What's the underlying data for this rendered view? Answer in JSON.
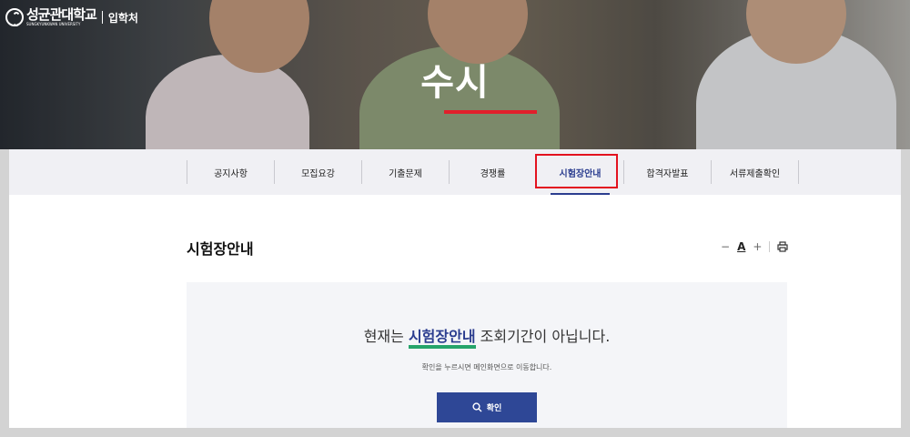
{
  "logo": {
    "name": "성균관대학교",
    "eng": "SUNGKYUNKWAN UNIVERSITY",
    "sub": "입학처"
  },
  "hero": {
    "title": "수시"
  },
  "tabs": [
    {
      "label": "공지사항"
    },
    {
      "label": "모집요강"
    },
    {
      "label": "기출문제"
    },
    {
      "label": "경쟁률"
    },
    {
      "label": "시험장안내",
      "active": true
    },
    {
      "label": "합격자발표"
    },
    {
      "label": "서류제출확인"
    }
  ],
  "page": {
    "title": "시험장안내",
    "tools": {
      "minus": "−",
      "font": "A",
      "plus": "+",
      "print_icon": "printer-icon"
    }
  },
  "notice": {
    "prefix": "현재는 ",
    "highlight": "시험장안내",
    "suffix": " 조회기간이 아닙니다.",
    "sub": "확인을 누르시면 메인화면으로 이동합니다.",
    "button": "확인",
    "button_icon": "search-icon"
  },
  "colors": {
    "accent": "#2b3d8f",
    "button": "#2e4796",
    "underline": "#26a46b",
    "hero_bar": "#e11f2b",
    "highlight_box": "#e3121f"
  }
}
